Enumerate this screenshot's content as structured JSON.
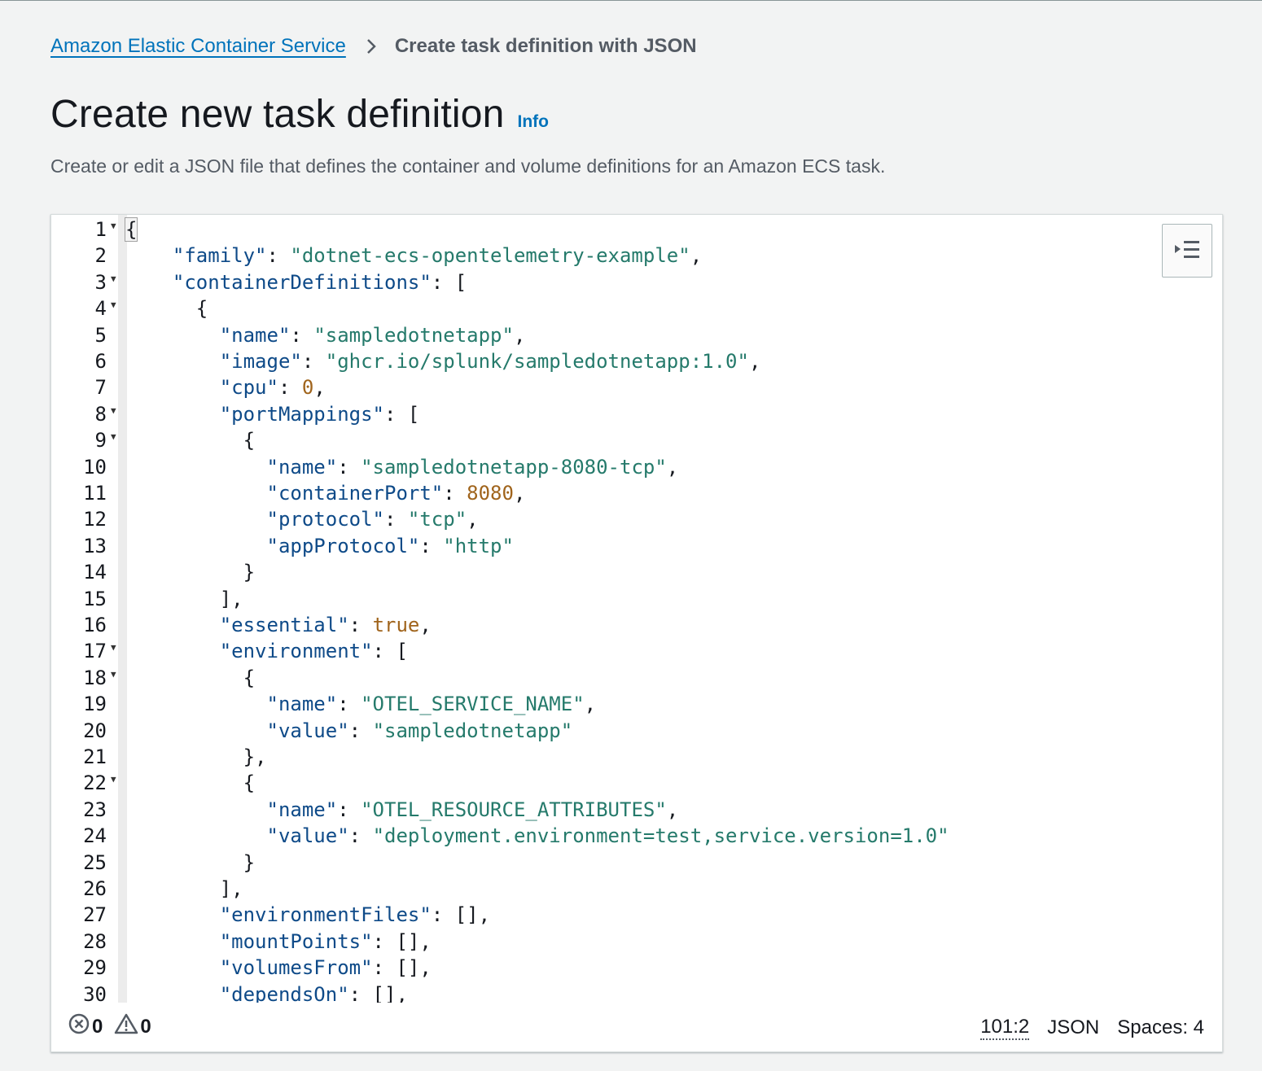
{
  "breadcrumb": {
    "parent": "Amazon Elastic Container Service",
    "current": "Create task definition with JSON"
  },
  "header": {
    "title": "Create new task definition",
    "info": "Info",
    "description": "Create or edit a JSON file that defines the container and volume definitions for an Amazon ECS task."
  },
  "editor": {
    "icons": {
      "wrap_toggle": "indent-icon",
      "error": "error-circle-icon",
      "warning": "warning-triangle-icon",
      "fold": "fold-arrow-icon"
    },
    "lines": [
      {
        "n": "1",
        "fold": true,
        "tokens": [
          {
            "t": "p",
            "v": "{",
            "cursor": true
          }
        ]
      },
      {
        "n": "2",
        "fold": false,
        "tokens": [
          {
            "t": "p",
            "v": "  "
          },
          {
            "t": "k",
            "v": "\"family\""
          },
          {
            "t": "p",
            "v": ": "
          },
          {
            "t": "s",
            "v": "\"dotnet-ecs-opentelemetry-example\""
          },
          {
            "t": "p",
            "v": ","
          }
        ]
      },
      {
        "n": "3",
        "fold": true,
        "tokens": [
          {
            "t": "p",
            "v": "  "
          },
          {
            "t": "k",
            "v": "\"containerDefinitions\""
          },
          {
            "t": "p",
            "v": ": ["
          }
        ]
      },
      {
        "n": "4",
        "fold": true,
        "tokens": [
          {
            "t": "p",
            "v": "    {"
          }
        ]
      },
      {
        "n": "5",
        "fold": false,
        "tokens": [
          {
            "t": "p",
            "v": "      "
          },
          {
            "t": "k",
            "v": "\"name\""
          },
          {
            "t": "p",
            "v": ": "
          },
          {
            "t": "s",
            "v": "\"sampledotnetapp\""
          },
          {
            "t": "p",
            "v": ","
          }
        ]
      },
      {
        "n": "6",
        "fold": false,
        "tokens": [
          {
            "t": "p",
            "v": "      "
          },
          {
            "t": "k",
            "v": "\"image\""
          },
          {
            "t": "p",
            "v": ": "
          },
          {
            "t": "s",
            "v": "\"ghcr.io/splunk/sampledotnetapp:1.0\""
          },
          {
            "t": "p",
            "v": ","
          }
        ]
      },
      {
        "n": "7",
        "fold": false,
        "tokens": [
          {
            "t": "p",
            "v": "      "
          },
          {
            "t": "k",
            "v": "\"cpu\""
          },
          {
            "t": "p",
            "v": ": "
          },
          {
            "t": "n",
            "v": "0"
          },
          {
            "t": "p",
            "v": ","
          }
        ]
      },
      {
        "n": "8",
        "fold": true,
        "tokens": [
          {
            "t": "p",
            "v": "      "
          },
          {
            "t": "k",
            "v": "\"portMappings\""
          },
          {
            "t": "p",
            "v": ": ["
          }
        ]
      },
      {
        "n": "9",
        "fold": true,
        "tokens": [
          {
            "t": "p",
            "v": "        {"
          }
        ]
      },
      {
        "n": "10",
        "fold": false,
        "tokens": [
          {
            "t": "p",
            "v": "          "
          },
          {
            "t": "k",
            "v": "\"name\""
          },
          {
            "t": "p",
            "v": ": "
          },
          {
            "t": "s",
            "v": "\"sampledotnetapp-8080-tcp\""
          },
          {
            "t": "p",
            "v": ","
          }
        ]
      },
      {
        "n": "11",
        "fold": false,
        "tokens": [
          {
            "t": "p",
            "v": "          "
          },
          {
            "t": "k",
            "v": "\"containerPort\""
          },
          {
            "t": "p",
            "v": ": "
          },
          {
            "t": "n",
            "v": "8080"
          },
          {
            "t": "p",
            "v": ","
          }
        ]
      },
      {
        "n": "12",
        "fold": false,
        "tokens": [
          {
            "t": "p",
            "v": "          "
          },
          {
            "t": "k",
            "v": "\"protocol\""
          },
          {
            "t": "p",
            "v": ": "
          },
          {
            "t": "s",
            "v": "\"tcp\""
          },
          {
            "t": "p",
            "v": ","
          }
        ]
      },
      {
        "n": "13",
        "fold": false,
        "tokens": [
          {
            "t": "p",
            "v": "          "
          },
          {
            "t": "k",
            "v": "\"appProtocol\""
          },
          {
            "t": "p",
            "v": ": "
          },
          {
            "t": "s",
            "v": "\"http\""
          }
        ]
      },
      {
        "n": "14",
        "fold": false,
        "tokens": [
          {
            "t": "p",
            "v": "        }"
          }
        ]
      },
      {
        "n": "15",
        "fold": false,
        "tokens": [
          {
            "t": "p",
            "v": "      ],"
          }
        ]
      },
      {
        "n": "16",
        "fold": false,
        "tokens": [
          {
            "t": "p",
            "v": "      "
          },
          {
            "t": "k",
            "v": "\"essential\""
          },
          {
            "t": "p",
            "v": ": "
          },
          {
            "t": "b",
            "v": "true"
          },
          {
            "t": "p",
            "v": ","
          }
        ]
      },
      {
        "n": "17",
        "fold": true,
        "tokens": [
          {
            "t": "p",
            "v": "      "
          },
          {
            "t": "k",
            "v": "\"environment\""
          },
          {
            "t": "p",
            "v": ": ["
          }
        ]
      },
      {
        "n": "18",
        "fold": true,
        "tokens": [
          {
            "t": "p",
            "v": "        {"
          }
        ]
      },
      {
        "n": "19",
        "fold": false,
        "tokens": [
          {
            "t": "p",
            "v": "          "
          },
          {
            "t": "k",
            "v": "\"name\""
          },
          {
            "t": "p",
            "v": ": "
          },
          {
            "t": "s",
            "v": "\"OTEL_SERVICE_NAME\""
          },
          {
            "t": "p",
            "v": ","
          }
        ]
      },
      {
        "n": "20",
        "fold": false,
        "tokens": [
          {
            "t": "p",
            "v": "          "
          },
          {
            "t": "k",
            "v": "\"value\""
          },
          {
            "t": "p",
            "v": ": "
          },
          {
            "t": "s",
            "v": "\"sampledotnetapp\""
          }
        ]
      },
      {
        "n": "21",
        "fold": false,
        "tokens": [
          {
            "t": "p",
            "v": "        },"
          }
        ]
      },
      {
        "n": "22",
        "fold": true,
        "tokens": [
          {
            "t": "p",
            "v": "        {"
          }
        ]
      },
      {
        "n": "23",
        "fold": false,
        "tokens": [
          {
            "t": "p",
            "v": "          "
          },
          {
            "t": "k",
            "v": "\"name\""
          },
          {
            "t": "p",
            "v": ": "
          },
          {
            "t": "s",
            "v": "\"OTEL_RESOURCE_ATTRIBUTES\""
          },
          {
            "t": "p",
            "v": ","
          }
        ]
      },
      {
        "n": "24",
        "fold": false,
        "tokens": [
          {
            "t": "p",
            "v": "          "
          },
          {
            "t": "k",
            "v": "\"value\""
          },
          {
            "t": "p",
            "v": ": "
          },
          {
            "t": "s",
            "v": "\"deployment.environment=test,service.version=1.0\""
          }
        ]
      },
      {
        "n": "25",
        "fold": false,
        "tokens": [
          {
            "t": "p",
            "v": "        }"
          }
        ]
      },
      {
        "n": "26",
        "fold": false,
        "tokens": [
          {
            "t": "p",
            "v": "      ],"
          }
        ]
      },
      {
        "n": "27",
        "fold": false,
        "tokens": [
          {
            "t": "p",
            "v": "      "
          },
          {
            "t": "k",
            "v": "\"environmentFiles\""
          },
          {
            "t": "p",
            "v": ": [],"
          }
        ]
      },
      {
        "n": "28",
        "fold": false,
        "tokens": [
          {
            "t": "p",
            "v": "      "
          },
          {
            "t": "k",
            "v": "\"mountPoints\""
          },
          {
            "t": "p",
            "v": ": [],"
          }
        ]
      },
      {
        "n": "29",
        "fold": false,
        "tokens": [
          {
            "t": "p",
            "v": "      "
          },
          {
            "t": "k",
            "v": "\"volumesFrom\""
          },
          {
            "t": "p",
            "v": ": [],"
          }
        ]
      },
      {
        "n": "30",
        "fold": false,
        "tokens": [
          {
            "t": "p",
            "v": "      "
          },
          {
            "t": "k",
            "v": "\"dependsOn\""
          },
          {
            "t": "p",
            "v": ": [],"
          }
        ]
      }
    ]
  },
  "statusbar": {
    "errors": "0",
    "warnings": "0",
    "cursor": "101:2",
    "language": "JSON",
    "indent": "Spaces: 4"
  },
  "colors": {
    "link": "#0073bb",
    "key": "#0e4a88",
    "string": "#257a6b",
    "number": "#a0641c"
  }
}
